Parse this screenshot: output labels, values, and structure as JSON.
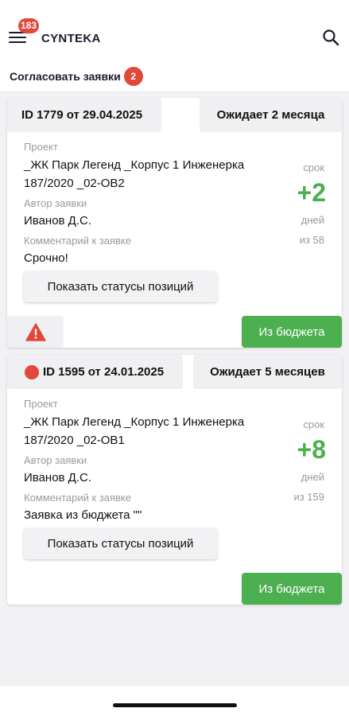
{
  "header": {
    "menu_badge": "183",
    "app_title": "CYNTEKA"
  },
  "tab": {
    "label": "Согласовать заявки",
    "badge": "2"
  },
  "colors": {
    "accent_green": "#4caf50",
    "badge_red": "#e0483a",
    "warning_red": "#e0483a"
  },
  "labels": {
    "project": "Проект",
    "author": "Автор заявки",
    "comment": "Комментарий к заявке",
    "term": "срок",
    "days": "дней",
    "show_statuses": "Показать статусы позиций",
    "from_budget": "Из бюджета"
  },
  "requests": [
    {
      "id_text": "ID 1779 от 29.04.2025",
      "waiting": "Ожидает 2 месяца",
      "has_red_dot": false,
      "project": "_ЖК Парк Легенд _Корпус 1 Инженерка 187/2020 _02-ОВ2",
      "author": "Иванов Д.С.",
      "comment": "Срочно!",
      "term_value": "+2",
      "term_of": "из 58",
      "warning_icon": "warning-triangle-icon"
    },
    {
      "id_text": "ID 1595 от 24.01.2025",
      "waiting": "Ожидает 5 месяцев",
      "has_red_dot": true,
      "project": "_ЖК Парк Легенд _Корпус 1 Инженерка 187/2020 _02-ОВ1",
      "author": "Иванов Д.С.",
      "comment": "Заявка из бюджета \"\"",
      "term_value": "+8",
      "term_of": "из 159"
    }
  ]
}
